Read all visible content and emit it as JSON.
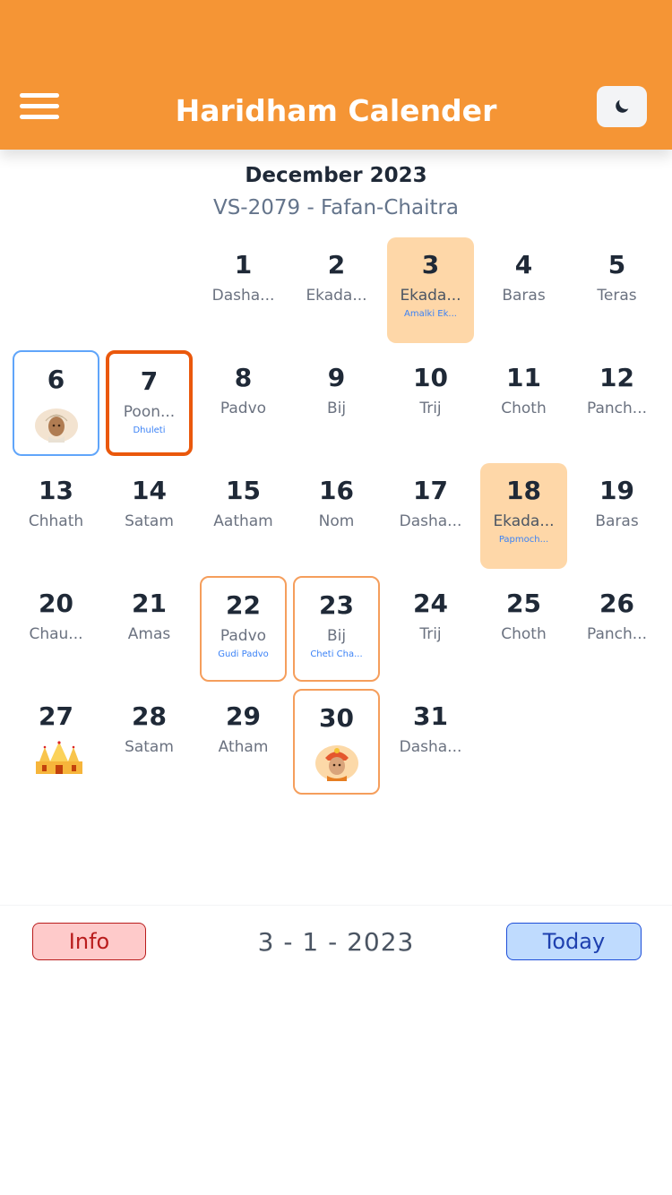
{
  "app": {
    "title": "Haridham Calender",
    "header_color": "#f59535"
  },
  "calendar": {
    "month_label": "December 2023",
    "vs_label": "VS-2079 - Fafan-Chaitra",
    "days": [
      {
        "num": "1",
        "tithi": "Dasha..."
      },
      {
        "num": "2",
        "tithi": "Ekada..."
      },
      {
        "num": "3",
        "tithi": "Ekada...",
        "event": "Amalki Ek...",
        "style": "highlight"
      },
      {
        "num": "4",
        "tithi": "Baras"
      },
      {
        "num": "5",
        "tithi": "Teras"
      },
      {
        "num": "6",
        "icon": "saint-portrait-icon",
        "style": "blue-outline"
      },
      {
        "num": "7",
        "tithi": "Poon...",
        "event": "Dhuleti",
        "style": "selected"
      },
      {
        "num": "8",
        "tithi": "Padvo"
      },
      {
        "num": "9",
        "tithi": "Bij"
      },
      {
        "num": "10",
        "tithi": "Trij"
      },
      {
        "num": "11",
        "tithi": "Choth"
      },
      {
        "num": "12",
        "tithi": "Panch..."
      },
      {
        "num": "13",
        "tithi": "Chhath"
      },
      {
        "num": "14",
        "tithi": "Satam"
      },
      {
        "num": "15",
        "tithi": "Aatham"
      },
      {
        "num": "16",
        "tithi": "Nom"
      },
      {
        "num": "17",
        "tithi": "Dasha..."
      },
      {
        "num": "18",
        "tithi": "Ekada...",
        "event": "Papmoch...",
        "style": "highlight"
      },
      {
        "num": "19",
        "tithi": "Baras"
      },
      {
        "num": "20",
        "tithi": "Chau..."
      },
      {
        "num": "21",
        "tithi": "Amas"
      },
      {
        "num": "22",
        "tithi": "Padvo",
        "event": "Gudi Padvo",
        "style": "orange-outline"
      },
      {
        "num": "23",
        "tithi": "Bij",
        "event": "Cheti Cha...",
        "style": "orange-outline"
      },
      {
        "num": "24",
        "tithi": "Trij"
      },
      {
        "num": "25",
        "tithi": "Choth"
      },
      {
        "num": "26",
        "tithi": "Panch..."
      },
      {
        "num": "27",
        "icon": "temple-icon"
      },
      {
        "num": "28",
        "tithi": "Satam"
      },
      {
        "num": "29",
        "tithi": "Atham"
      },
      {
        "num": "30",
        "icon": "swami-portrait-icon",
        "style": "orange-outline"
      },
      {
        "num": "31",
        "tithi": "Dasha..."
      }
    ]
  },
  "footer": {
    "info_label": "Info",
    "date_display": "3 - 1 - 2023",
    "today_label": "Today"
  },
  "colors": {
    "highlight": "#fed7a8",
    "orange_outline": "#f59e5c",
    "selected_border": "#ea580c",
    "blue_outline": "#60a5fa",
    "event_text": "#3b82f6",
    "info_bg": "#fecaca",
    "today_bg": "#bfdbfe"
  }
}
